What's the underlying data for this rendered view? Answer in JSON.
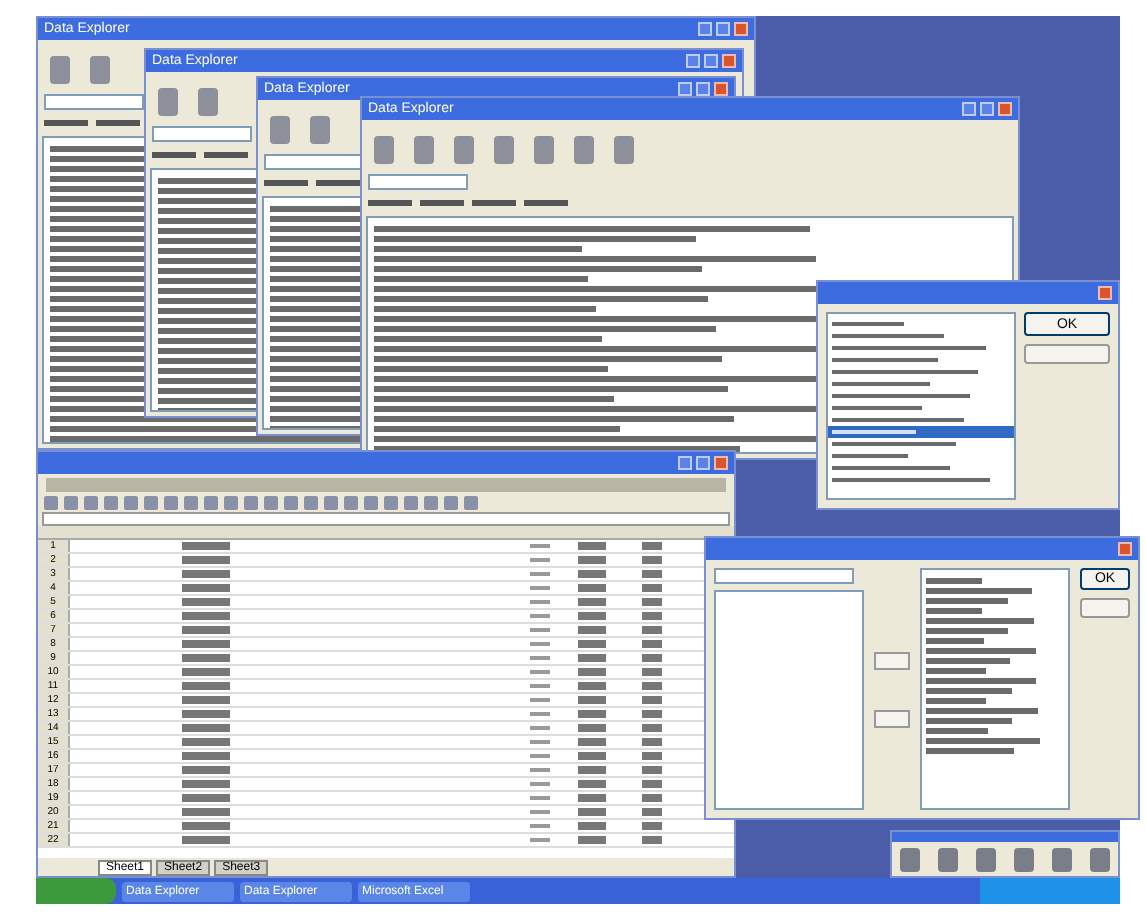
{
  "windows": [
    {
      "title": "Data Explorer"
    },
    {
      "title": "Data Explorer"
    },
    {
      "title": "Data Explorer"
    },
    {
      "title": "Data Explorer"
    }
  ],
  "list_dialog": {
    "items": [
      {
        "selected": false
      },
      {
        "selected": false
      },
      {
        "selected": false
      },
      {
        "selected": false
      },
      {
        "selected": false
      },
      {
        "selected": false
      },
      {
        "selected": false
      },
      {
        "selected": false
      },
      {
        "selected": false
      },
      {
        "selected": true
      },
      {
        "selected": false
      },
      {
        "selected": false
      },
      {
        "selected": false
      },
      {
        "selected": false
      }
    ],
    "buttons": [
      "OK"
    ]
  },
  "spreadsheet": {
    "row_numbers": [
      "1",
      "2",
      "3",
      "4",
      "5",
      "6",
      "7",
      "8",
      "9",
      "10",
      "11",
      "12",
      "13",
      "14",
      "15",
      "16",
      "17",
      "18",
      "19",
      "20",
      "21",
      "22"
    ],
    "sheet_tabs": [
      {
        "label": "Sheet1",
        "selected": true
      },
      {
        "label": "Sheet2",
        "selected": false
      },
      {
        "label": "Sheet3",
        "selected": false
      }
    ]
  },
  "settings_dialog": {
    "buttons": [
      "OK"
    ]
  },
  "taskbar": {
    "items": [
      {
        "label": "Data Explorer"
      },
      {
        "label": "Data Explorer"
      },
      {
        "label": "Microsoft Excel"
      }
    ]
  }
}
